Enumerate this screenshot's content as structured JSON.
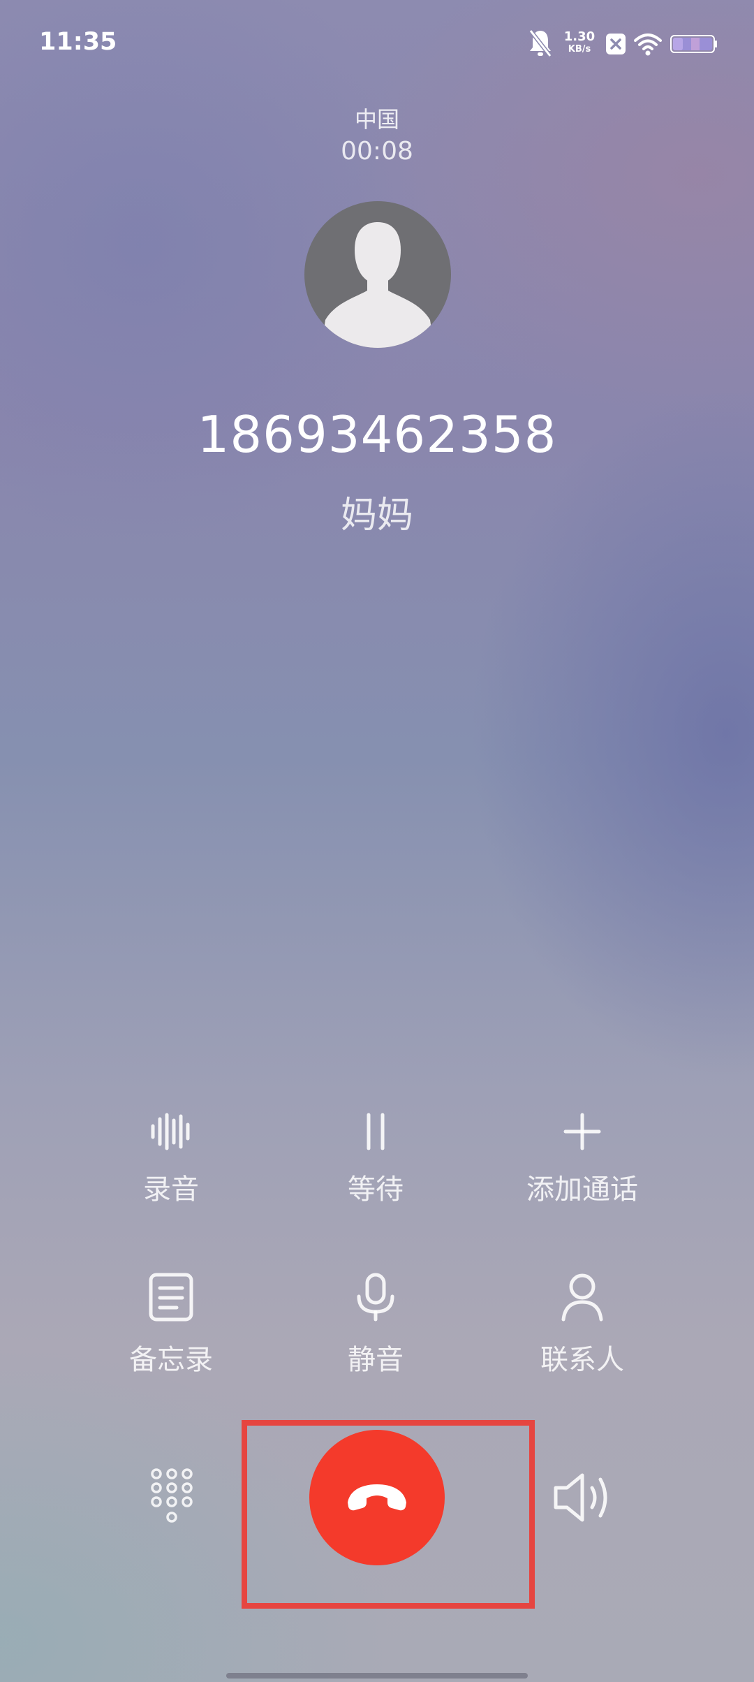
{
  "status_bar": {
    "time": "11:35",
    "net_speed_value": "1.30",
    "net_speed_unit": "KB/s",
    "icons": [
      "bell-muted-icon",
      "close-box-icon",
      "wifi-icon",
      "battery-icon"
    ]
  },
  "caller": {
    "location": "中国",
    "duration": "00:08",
    "number": "18693462358",
    "name": "妈妈"
  },
  "controls": [
    {
      "label": "录音",
      "icon": "record-waveform-icon"
    },
    {
      "label": "等待",
      "icon": "pause-icon"
    },
    {
      "label": "添加通话",
      "icon": "plus-icon"
    },
    {
      "label": "备忘录",
      "icon": "memo-icon"
    },
    {
      "label": "静音",
      "icon": "microphone-icon"
    },
    {
      "label": "联系人",
      "icon": "person-icon"
    }
  ],
  "bottom": {
    "keypad_icon": "dialpad-icon",
    "end_call_icon": "hang-up-icon",
    "speaker_icon": "speaker-icon"
  },
  "colors": {
    "end_call": "#f43a2b",
    "highlight_box": "#e64540"
  }
}
